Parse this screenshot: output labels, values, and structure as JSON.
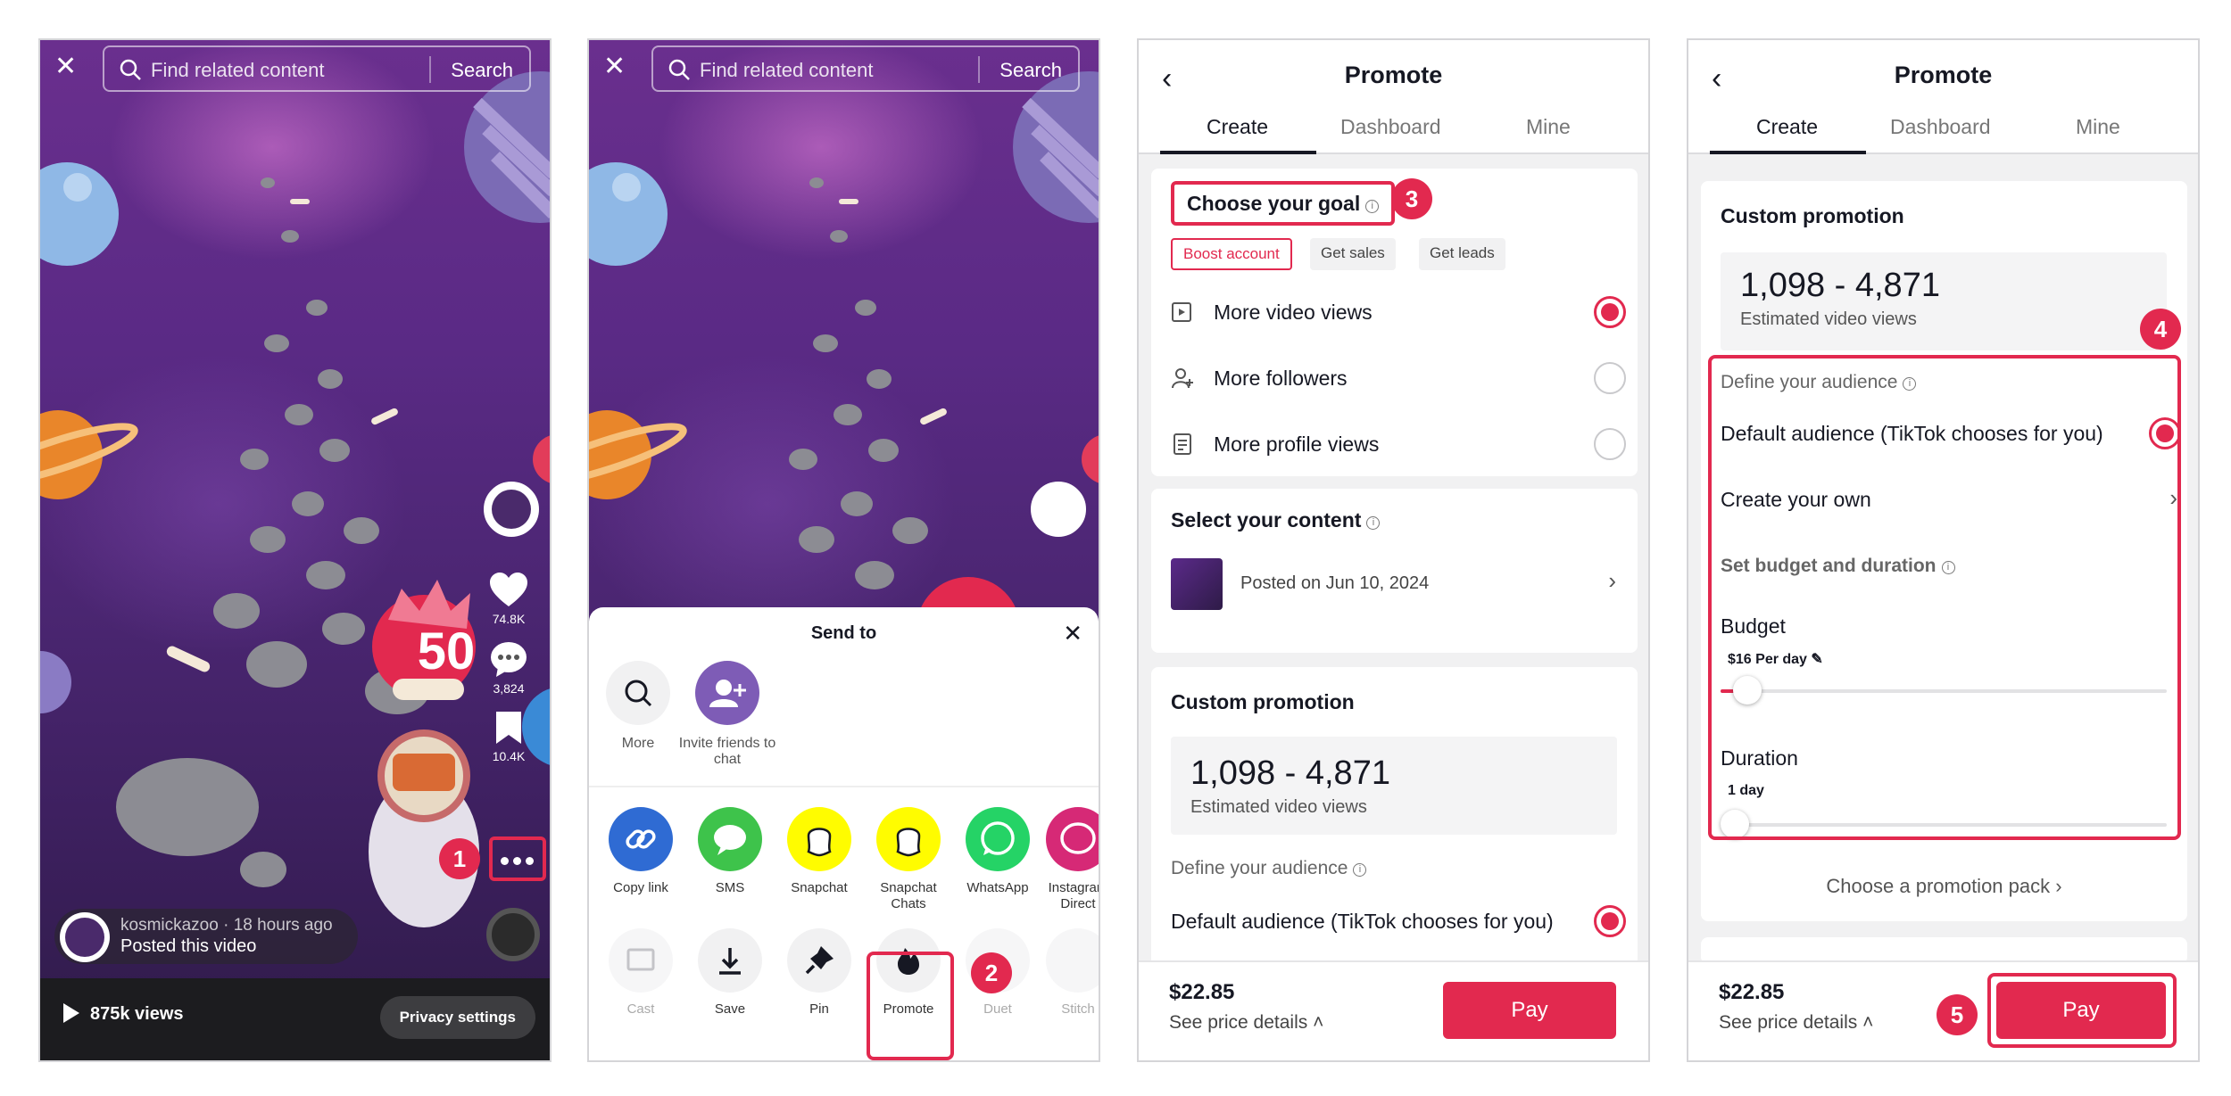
{
  "video": {
    "search_placeholder": "Find related content",
    "search_button": "Search",
    "likes": "74.8K",
    "comments": "3,824",
    "saves": "10.4K",
    "username": "kosmickazoo · 18 hours ago",
    "post_caption": "Posted this video",
    "views": "875k views",
    "privacy_button": "Privacy settings",
    "sticker_text": "50"
  },
  "share_sheet": {
    "title": "Send to",
    "top_items": [
      {
        "label": "More",
        "icon": "search-icon"
      },
      {
        "label": "Invite friends to chat",
        "icon": "add-friend-icon"
      }
    ],
    "apps": [
      {
        "label": "Copy link",
        "icon": "link-icon",
        "color": "#2f6bd3"
      },
      {
        "label": "SMS",
        "icon": "chat-bubble-icon",
        "color": "#3ec34b"
      },
      {
        "label": "Snapchat",
        "icon": "ghost-icon",
        "color": "#fffc00"
      },
      {
        "label": "Snapchat Chats",
        "icon": "ghost-icon",
        "color": "#fffc00"
      },
      {
        "label": "WhatsApp",
        "icon": "whatsapp-icon",
        "color": "#25d366"
      },
      {
        "label": "Instagram Direct",
        "icon": "messenger-icon",
        "color": "#d62976"
      }
    ],
    "actions": [
      {
        "label": "Cast",
        "icon": "cast-icon"
      },
      {
        "label": "Save",
        "icon": "download-icon"
      },
      {
        "label": "Pin",
        "icon": "pin-icon"
      },
      {
        "label": "Promote",
        "icon": "flame-icon"
      },
      {
        "label": "Duet",
        "icon": "duet-icon"
      },
      {
        "label": "Stitch",
        "icon": "stitch-icon"
      }
    ]
  },
  "steps": [
    "1",
    "2",
    "3",
    "4",
    "5"
  ],
  "promote": {
    "title": "Promote",
    "tabs": [
      "Create",
      "Dashboard",
      "Mine"
    ],
    "goal_title": "Choose your goal",
    "goal_chips": [
      "Boost account",
      "Get sales",
      "Get leads"
    ],
    "goal_options": [
      "More video views",
      "More followers",
      "More profile views"
    ],
    "content_title": "Select your content",
    "content_posted": "Posted on Jun 10, 2024",
    "custom_title": "Custom promotion",
    "estimate": "1,098 - 4,871",
    "estimate_label": "Estimated video views",
    "audience_title": "Define your audience",
    "audience_default": "Default audience (TikTok chooses for you)",
    "audience_custom": "Create your own",
    "budget_section": "Set budget and duration",
    "budget_label": "Budget",
    "budget_value": "$16 Per day",
    "budget_level": 0.03,
    "duration_label": "Duration",
    "duration_value": "1 day",
    "duration_level": 0.0,
    "promo_pack": "Choose a promotion pack",
    "price": "$22.85",
    "price_details": "See price details",
    "pay": "Pay"
  },
  "colors": {
    "accent": "#e2294f",
    "text": "#161823"
  }
}
